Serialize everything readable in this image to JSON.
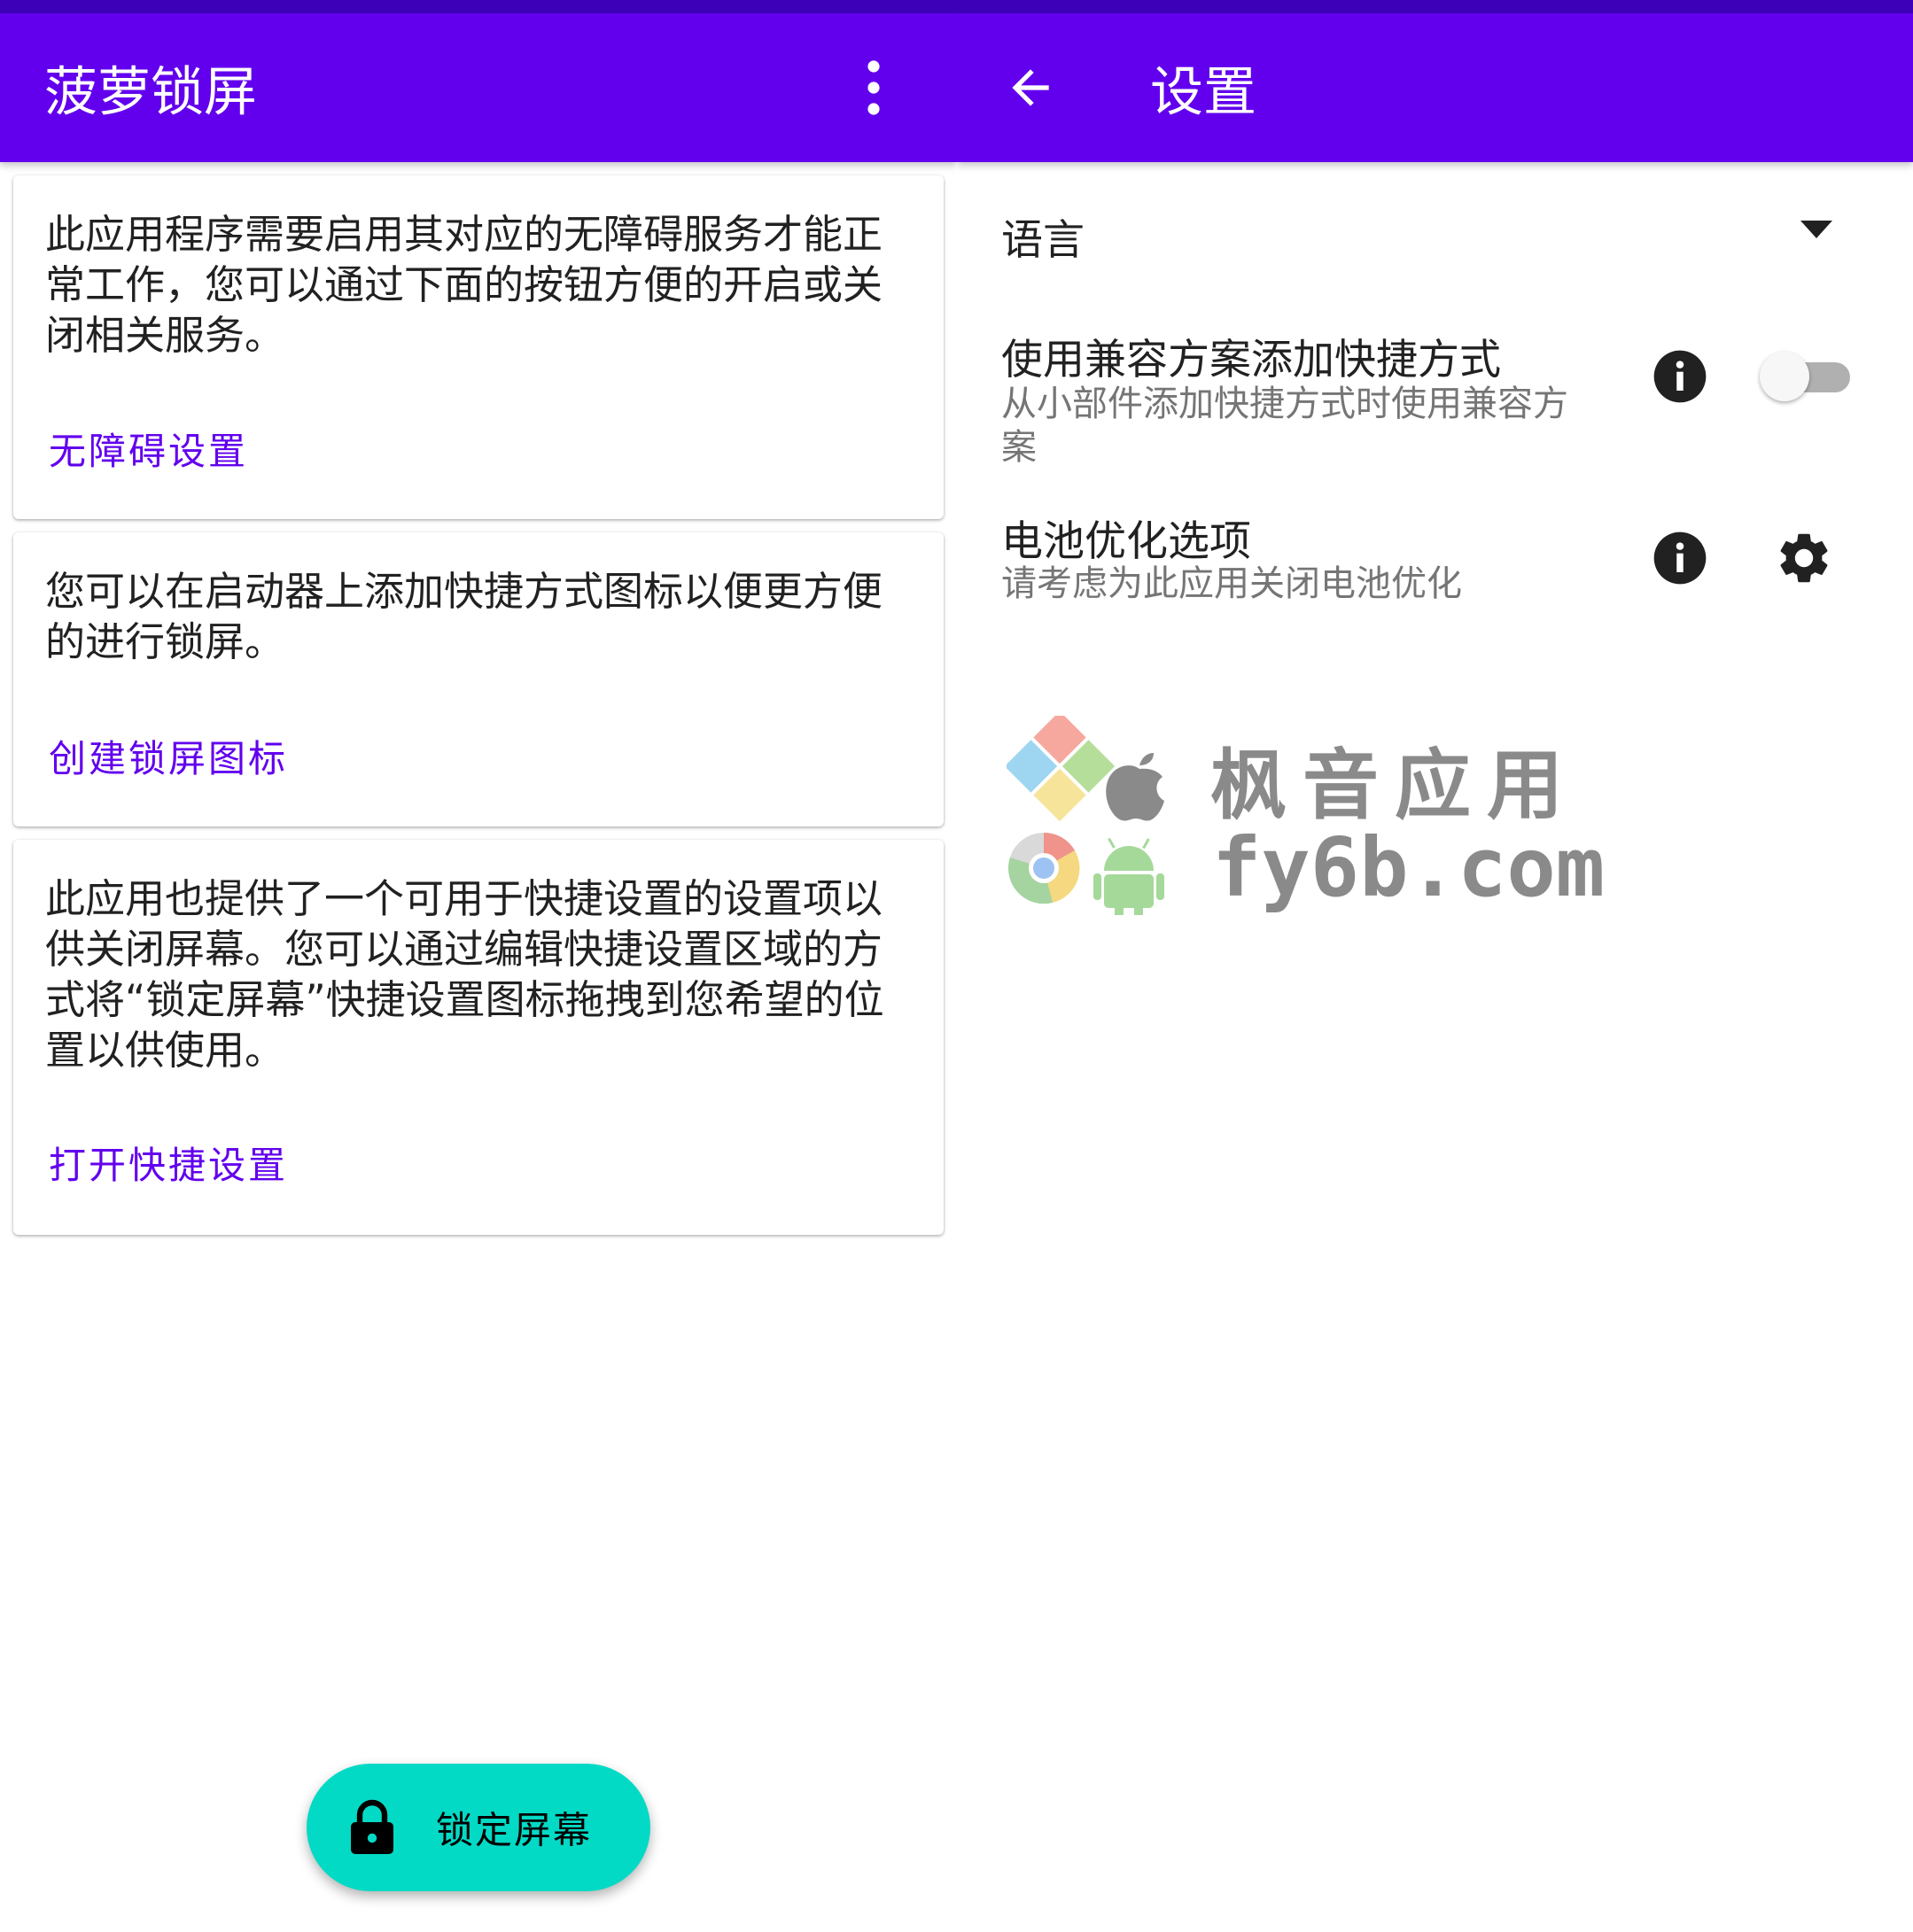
{
  "main_screen": {
    "app_title": "菠萝锁屏",
    "cards": [
      {
        "text": "此应用程序需要启用其对应的无障碍服务才能正常工作，您可以通过下面的按钮方便的开启或关闭相关服务。",
        "action_label": "无障碍设置"
      },
      {
        "text": "您可以在启动器上添加快捷方式图标以便更方便的进行锁屏。",
        "action_label": "创建锁屏图标"
      },
      {
        "text": "此应用也提供了一个可用于快捷设置的设置项以供关闭屏幕。您可以通过编辑快捷设置区域的方式将“锁定屏幕”快捷设置图标拖拽到您希望的位置以供使用。",
        "action_label": "打开快捷设置"
      }
    ],
    "fab": {
      "label": "锁定屏幕",
      "icon": "lock-icon",
      "color": "#03dac5"
    }
  },
  "settings_screen": {
    "title": "设置",
    "back_icon": "arrow-back-icon",
    "preferences": {
      "language": {
        "title": "语言",
        "icon": "arrow-drop-down-icon"
      },
      "compat_shortcut": {
        "title": "使用兼容方案添加快捷方式",
        "summary": "从小部件添加快捷方式时使用兼容方案",
        "enabled": false
      },
      "battery": {
        "title": "电池优化选项",
        "summary": "请考虑为此应用关闭电池优化",
        "icon": "gear-icon"
      }
    }
  },
  "watermark": {
    "text_cn": "枫音应用",
    "text_url": "fy6b.com"
  },
  "colors": {
    "primary": "#6200ee",
    "status_bar": "#3d00b8",
    "accent": "#03dac5"
  }
}
